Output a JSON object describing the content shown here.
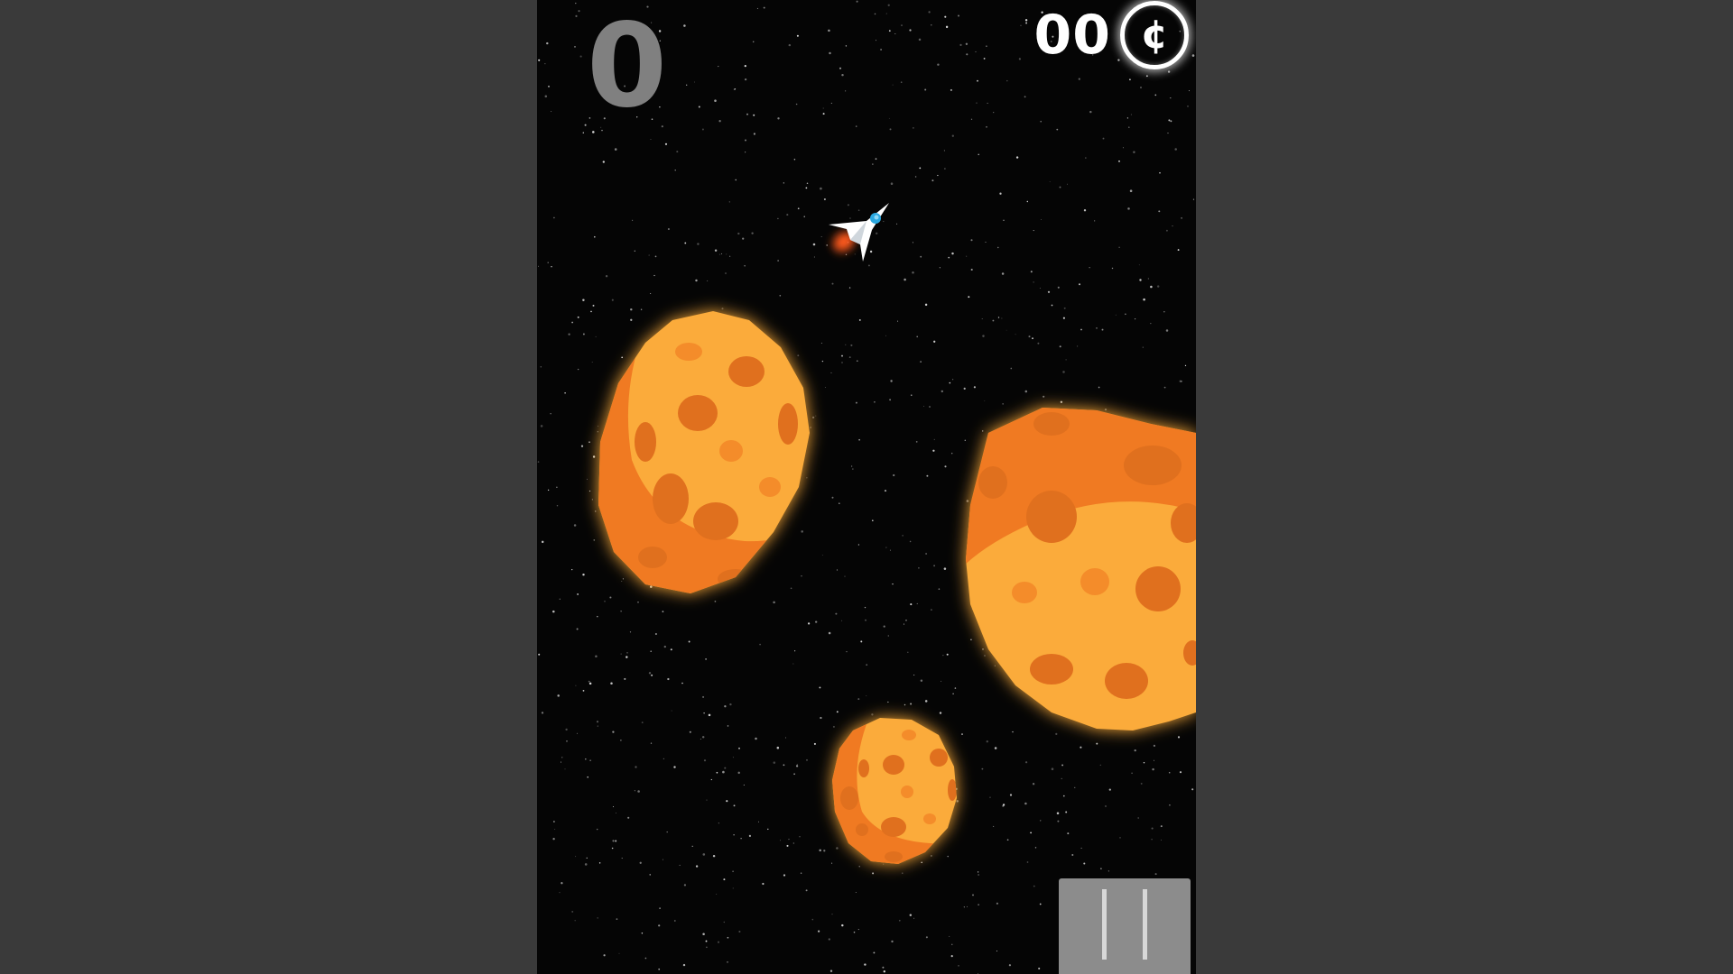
{
  "hud": {
    "score": "0",
    "coin_count": "00",
    "coin_symbol": "¢",
    "pause_icon": "pause-icon"
  },
  "colors": {
    "outer_background": "#3a3a3a",
    "space": "#050505",
    "score_text": "#808080",
    "coin_text": "#ffffff",
    "asteroid_light": "#fbab3a",
    "asteroid_dark": "#f07a22",
    "asteroid_crater": "#e0701e",
    "asteroid_glow": "#ff8a1a",
    "pause_button": "#8c8c8c",
    "ship": "#ffffff",
    "ship_cockpit": "#2aa8e0",
    "thruster": "#ff5a1a"
  },
  "entities": {
    "player": "spaceship",
    "asteroids": [
      "asteroid",
      "asteroid",
      "asteroid"
    ]
  }
}
